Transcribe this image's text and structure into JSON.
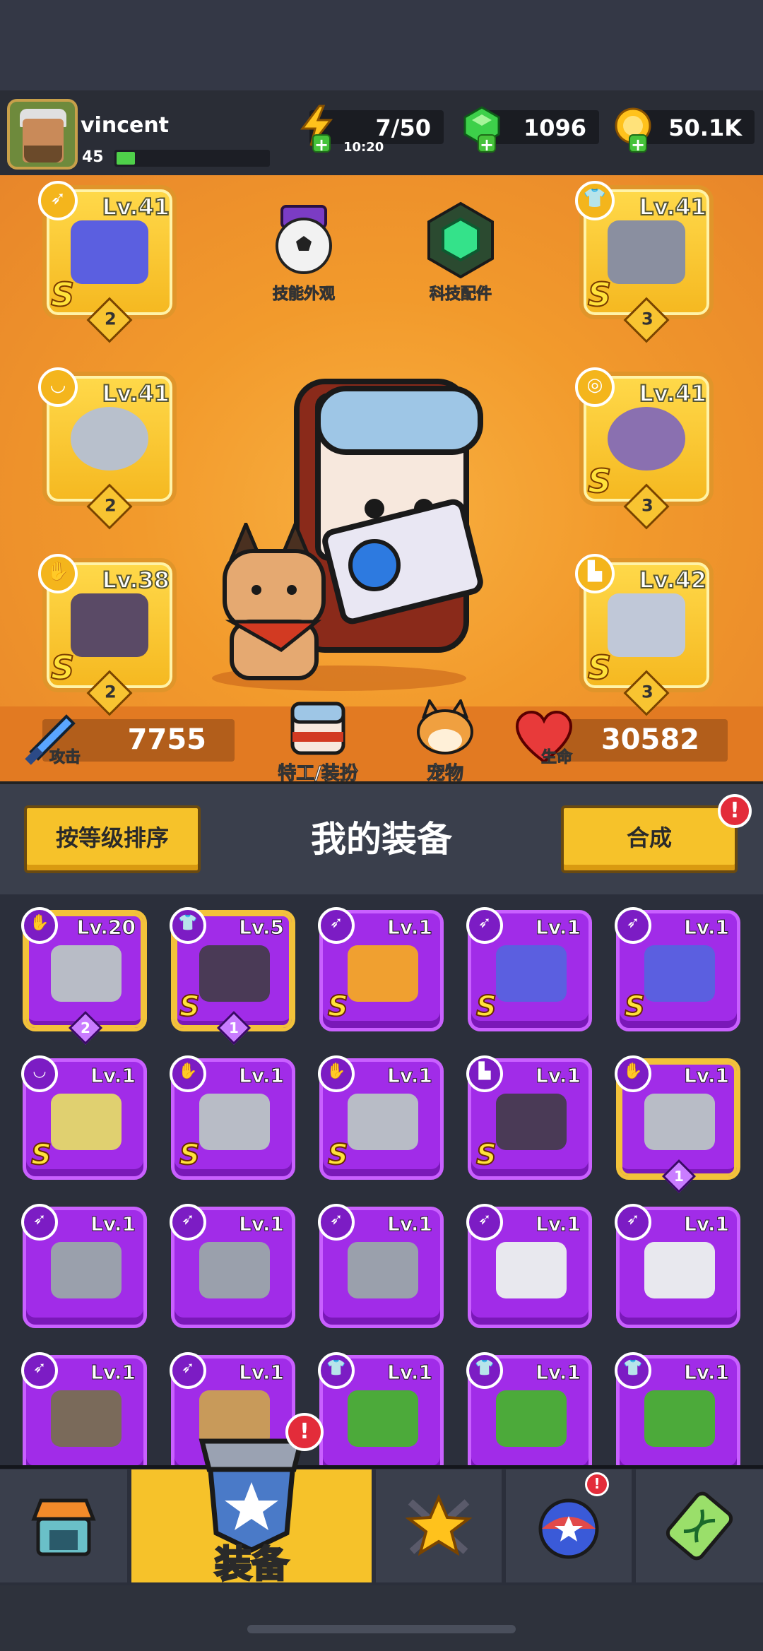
{
  "player": {
    "name": "vincent",
    "level": "45",
    "xp_fraction": 0.12
  },
  "resources": {
    "energy": {
      "value": "7/50",
      "timer": "10:20"
    },
    "gems": {
      "value": "1096"
    },
    "coins": {
      "value": "50.1K"
    }
  },
  "equipped": {
    "weapon": {
      "level": "Lv.41",
      "rank": "S",
      "stars": "2",
      "icon": "blaster-gun-icon"
    },
    "armor": {
      "level": "Lv.41",
      "rank": "S",
      "stars": "3",
      "icon": "mech-armor-icon"
    },
    "necklace": {
      "level": "Lv.41",
      "rank": "",
      "stars": "2",
      "icon": "spiked-collar-icon"
    },
    "belt": {
      "level": "Lv.41",
      "rank": "S",
      "stars": "3",
      "icon": "gem-ring-icon"
    },
    "gloves": {
      "level": "Lv.38",
      "rank": "S",
      "stars": "2",
      "icon": "gauntlet-icon"
    },
    "boots": {
      "level": "Lv.42",
      "rank": "S",
      "stars": "3",
      "icon": "boot-icon"
    }
  },
  "center_buttons": {
    "skill_skin": "技能外观",
    "tech_parts": "科技配件",
    "agent_outfit": "特工/装扮",
    "pet": "宠物"
  },
  "stats": {
    "attack_label": "攻击",
    "attack_value": "7755",
    "hp_label": "生命",
    "hp_value": "30582"
  },
  "inventory": {
    "sort_button": "按等级排序",
    "title": "我的装备",
    "merge_button": "合成",
    "merge_alert": "!",
    "items": [
      {
        "level": "Lv.20",
        "rank": "",
        "stars": "2",
        "icon": "gauntlet-icon",
        "selected": true
      },
      {
        "level": "Lv.5",
        "rank": "S",
        "stars": "1",
        "icon": "dark-armor-icon",
        "selected": true
      },
      {
        "level": "Lv.1",
        "rank": "S",
        "stars": "",
        "icon": "flame-sword-icon",
        "selected": false
      },
      {
        "level": "Lv.1",
        "rank": "S",
        "stars": "",
        "icon": "blaster-gun-icon",
        "selected": false
      },
      {
        "level": "Lv.1",
        "rank": "S",
        "stars": "",
        "icon": "blaster-gun-icon",
        "selected": false
      },
      {
        "level": "Lv.1",
        "rank": "S",
        "stars": "",
        "icon": "star-ring-icon",
        "selected": false
      },
      {
        "level": "Lv.1",
        "rank": "S",
        "stars": "",
        "icon": "gauntlet-icon",
        "selected": false
      },
      {
        "level": "Lv.1",
        "rank": "S",
        "stars": "",
        "icon": "gauntlet-icon",
        "selected": false
      },
      {
        "level": "Lv.1",
        "rank": "S",
        "stars": "",
        "icon": "dark-boot-icon",
        "selected": false
      },
      {
        "level": "Lv.1",
        "rank": "",
        "stars": "1",
        "icon": "gauntlet-icon",
        "selected": true
      },
      {
        "level": "Lv.1",
        "rank": "",
        "stars": "",
        "icon": "kunai-icon",
        "selected": false
      },
      {
        "level": "Lv.1",
        "rank": "",
        "stars": "",
        "icon": "kunai-icon",
        "selected": false
      },
      {
        "level": "Lv.1",
        "rank": "",
        "stars": "",
        "icon": "kunai-icon",
        "selected": false
      },
      {
        "level": "Lv.1",
        "rank": "",
        "stars": "",
        "icon": "katana-icon",
        "selected": false
      },
      {
        "level": "Lv.1",
        "rank": "",
        "stars": "",
        "icon": "katana-icon",
        "selected": false
      },
      {
        "level": "Lv.1",
        "rank": "",
        "stars": "",
        "icon": "shotgun-icon",
        "selected": false
      },
      {
        "level": "Lv.1",
        "rank": "",
        "stars": "",
        "icon": "club-icon",
        "selected": false
      },
      {
        "level": "Lv.1",
        "rank": "",
        "stars": "",
        "icon": "leaf-armor-icon",
        "selected": false
      },
      {
        "level": "Lv.1",
        "rank": "",
        "stars": "",
        "icon": "leaf-armor-icon",
        "selected": false
      },
      {
        "level": "Lv.1",
        "rank": "",
        "stars": "",
        "icon": "leaf-armor-icon",
        "selected": false
      }
    ]
  },
  "nav": {
    "equipment_label": "装备",
    "equipment_alert": "!",
    "events_alert": "!"
  },
  "colors": {
    "accent_yellow": "#f6c22a",
    "item_purple": "#a12ce8",
    "stage_orange": "#f29a2c",
    "alert_red": "#e32c3a"
  }
}
